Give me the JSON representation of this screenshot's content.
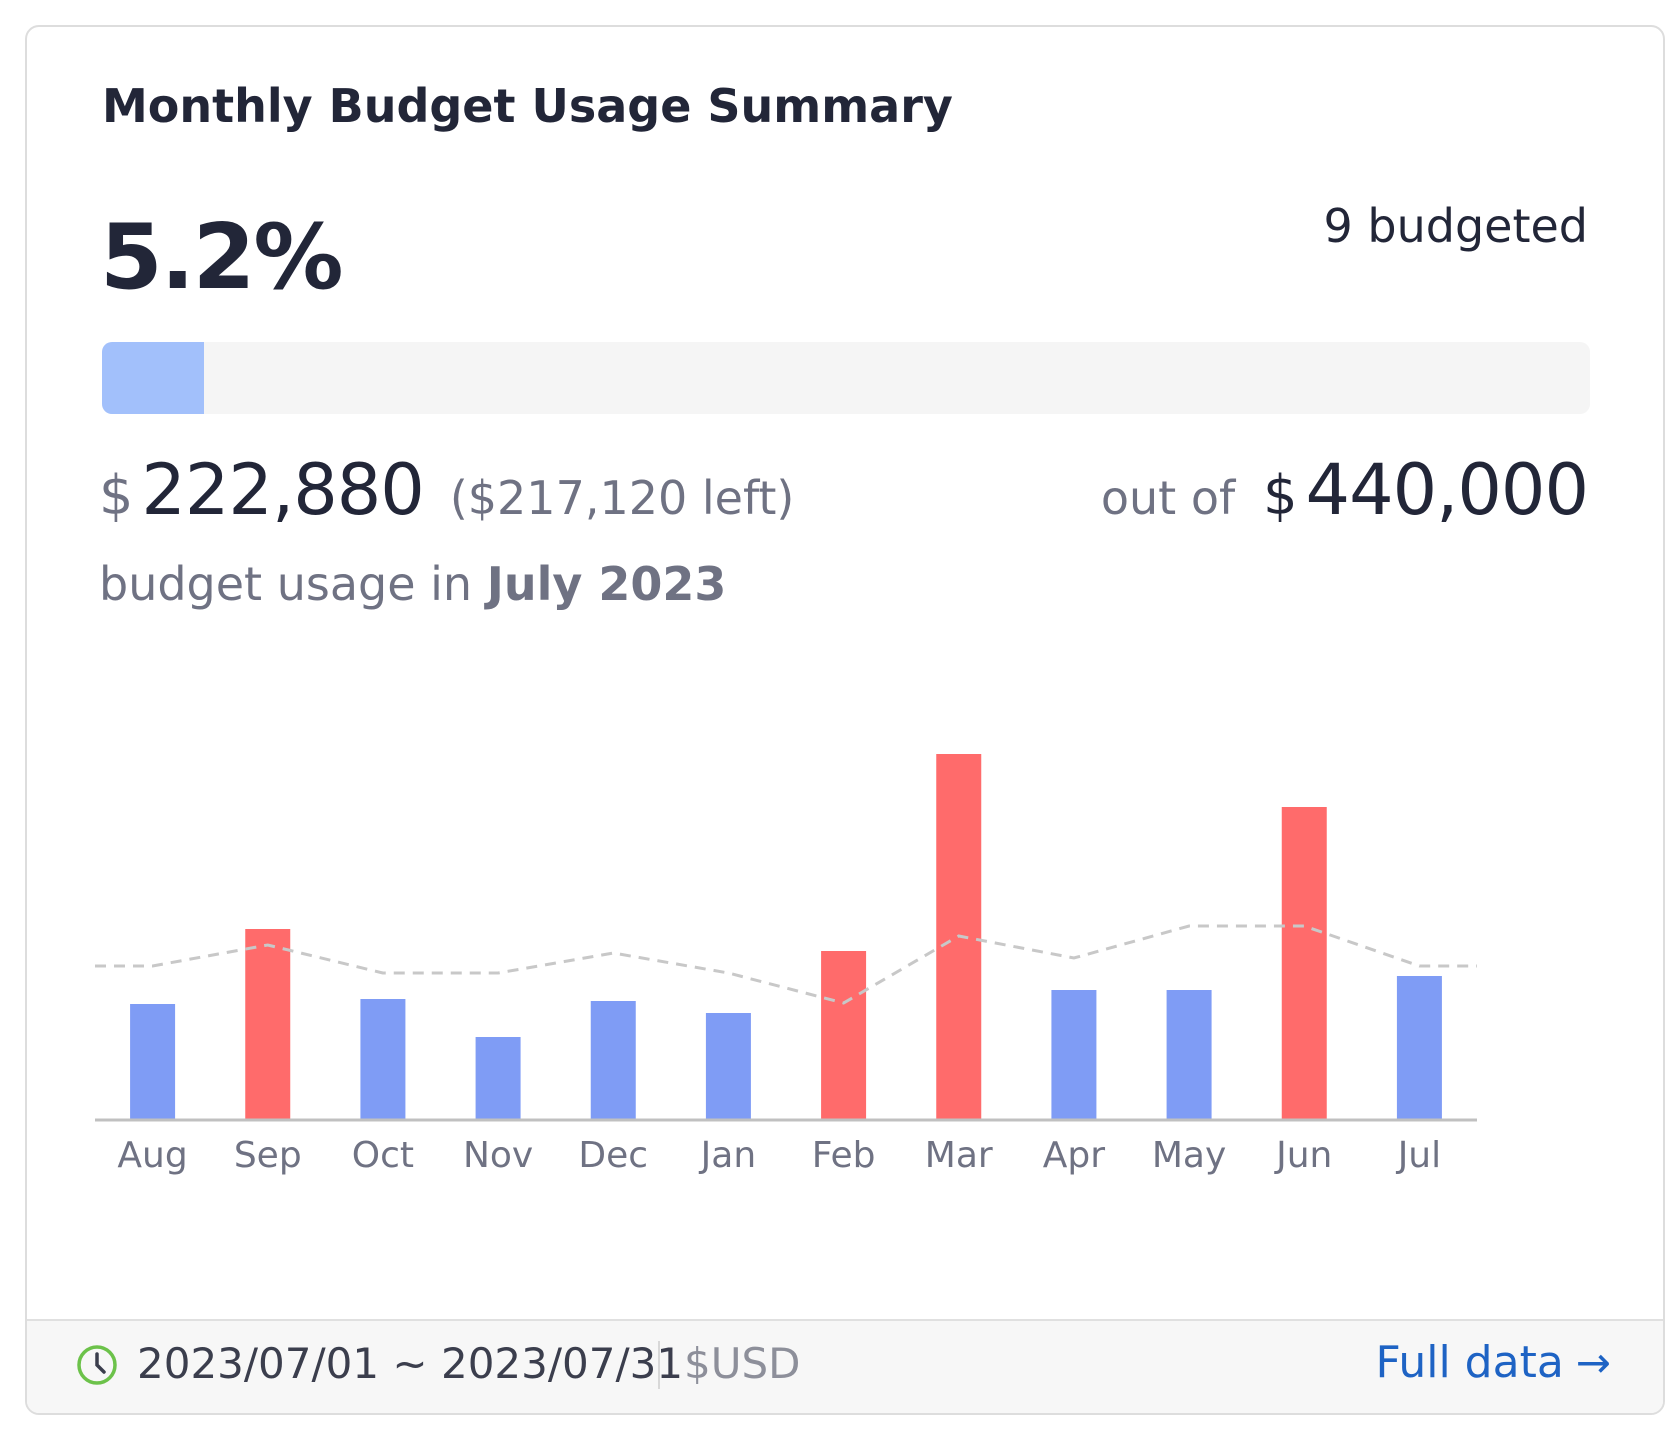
{
  "card": {
    "title": "Monthly Budget Usage Summary",
    "percent": "5.2%",
    "percent_value": 5.2,
    "budgeted": "9 budgeted",
    "spent_currency": "$",
    "spent_amount": "222,880",
    "left_note": "($217,120 left)",
    "out_of_label": "out of",
    "total_currency": "$",
    "total_amount": "440,000",
    "usage_prefix": "budget usage in",
    "usage_month": "July 2023"
  },
  "chart_data": {
    "type": "bar",
    "categories": [
      "Aug",
      "Sep",
      "Oct",
      "Nov",
      "Dec",
      "Jan",
      "Feb",
      "Mar",
      "Apr",
      "May",
      "Jun",
      "Jul"
    ],
    "values": [
      115,
      190,
      120,
      82,
      118,
      106,
      168,
      365,
      129,
      129,
      312,
      143
    ],
    "over_budget": [
      false,
      true,
      false,
      false,
      false,
      false,
      true,
      true,
      false,
      false,
      true,
      false
    ],
    "reference_line": {
      "style": "dashed",
      "values": [
        153,
        174,
        146,
        146,
        166,
        146,
        116,
        183,
        161,
        193,
        193,
        153
      ]
    },
    "ylim": [
      0,
      400
    ],
    "grid": false,
    "legend": "none",
    "colors": {
      "under": "#7f9cf5",
      "over": "#ff6b6b",
      "reference": "#c8c8c8",
      "axis": "#c0c0c0"
    }
  },
  "footer": {
    "clock_icon": "clock-icon",
    "date_range": "2023/07/01 ~ 2023/07/31",
    "currency": "$USD",
    "full_data_label": "Full data",
    "arrow": "→"
  },
  "colors": {
    "progress_fill": "#a2c0fb",
    "progress_track": "#f5f5f5",
    "link": "#1e63c4",
    "clock": "#6cc24a"
  }
}
